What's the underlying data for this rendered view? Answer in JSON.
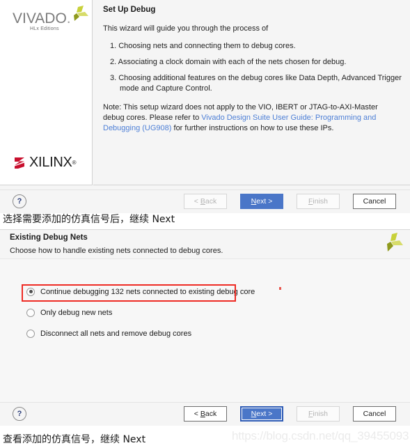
{
  "dialog_one": {
    "branding": {
      "product": "VIVADO",
      "product_dot": ".",
      "edition": "HLx Editions",
      "vendor": "XILINX",
      "vendor_reg": "®",
      "leaf_icon": "vivado-leaf-icon"
    },
    "title": "Set Up Debug",
    "intro": "This wizard will guide you through the process of",
    "steps": [
      "1.  Choosing nets and connecting them to debug cores.",
      "2.  Associating a clock domain with each of the nets chosen for debug.",
      "3.  Choosing additional features on the debug cores like Data Depth, Advanced Trigger mode and Capture Control."
    ],
    "note": {
      "before_link": "Note: This setup wizard does not apply to the VIO, IBERT or JTAG-to-AXI-Master debug cores. Please refer to ",
      "link_text": "Vivado Design Suite User Guide: Programming and Debugging (UG908)",
      "after_link": " for further instructions on how to use these IPs."
    },
    "footer": {
      "help_label": "?",
      "back_label": "< Back",
      "next_label": "Next >",
      "finish_label": "Finish",
      "cancel_label": "Cancel"
    }
  },
  "caption_one": "选择需要添加的仿真信号后，继续 Next",
  "dialog_two": {
    "title": "Existing Debug Nets",
    "subtitle": "Choose how to handle existing nets connected to debug cores.",
    "propeller_icon": "propeller-logo-icon",
    "options": [
      {
        "label": "Continue debugging 132 nets connected to existing debug core",
        "checked": true
      },
      {
        "label": "Only debug new nets",
        "checked": false
      },
      {
        "label": "Disconnect all nets and remove debug cores",
        "checked": false
      }
    ],
    "highlight_color": "#ee2b24",
    "footer": {
      "help_label": "?",
      "back_label": "< Back",
      "next_label": "Next >",
      "finish_label": "Finish",
      "cancel_label": "Cancel"
    }
  },
  "caption_two": "查看添加的仿真信号，继续 Next",
  "watermark": "https://blog.csdn.net/qq_39455093"
}
